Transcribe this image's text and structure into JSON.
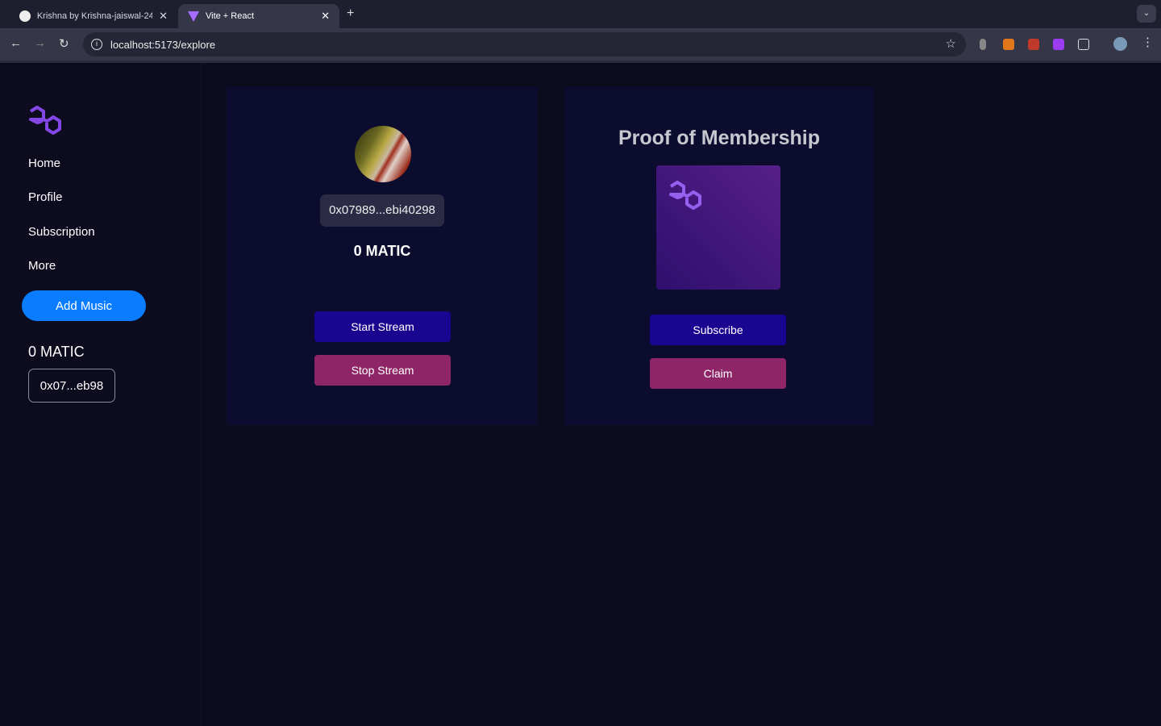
{
  "browser": {
    "tabs": [
      {
        "label": "Krishna by Krishna-jaiswal-24",
        "icon": "github-icon"
      },
      {
        "label": "Vite + React",
        "icon": "vite-icon",
        "active": true
      }
    ],
    "url": "localhost:5173/explore"
  },
  "sidebar": {
    "items": [
      {
        "label": "Home"
      },
      {
        "label": "Profile"
      },
      {
        "label": "Subscription"
      },
      {
        "label": "More"
      }
    ],
    "add_music": "Add Music",
    "balance": "0 MATIC",
    "address": "0x07...eb98"
  },
  "stream_card": {
    "address": "0x07989...ebi40298",
    "balance": "0 MATIC",
    "start": "Start Stream",
    "stop": "Stop Stream"
  },
  "membership_card": {
    "title": "Proof of Membership",
    "subscribe": "Subscribe",
    "claim": "Claim"
  },
  "colors": {
    "accent": "#0a7cff",
    "primary_button": "#1a0590",
    "secondary_button": "#8e2567",
    "logo": "#8247e5"
  }
}
